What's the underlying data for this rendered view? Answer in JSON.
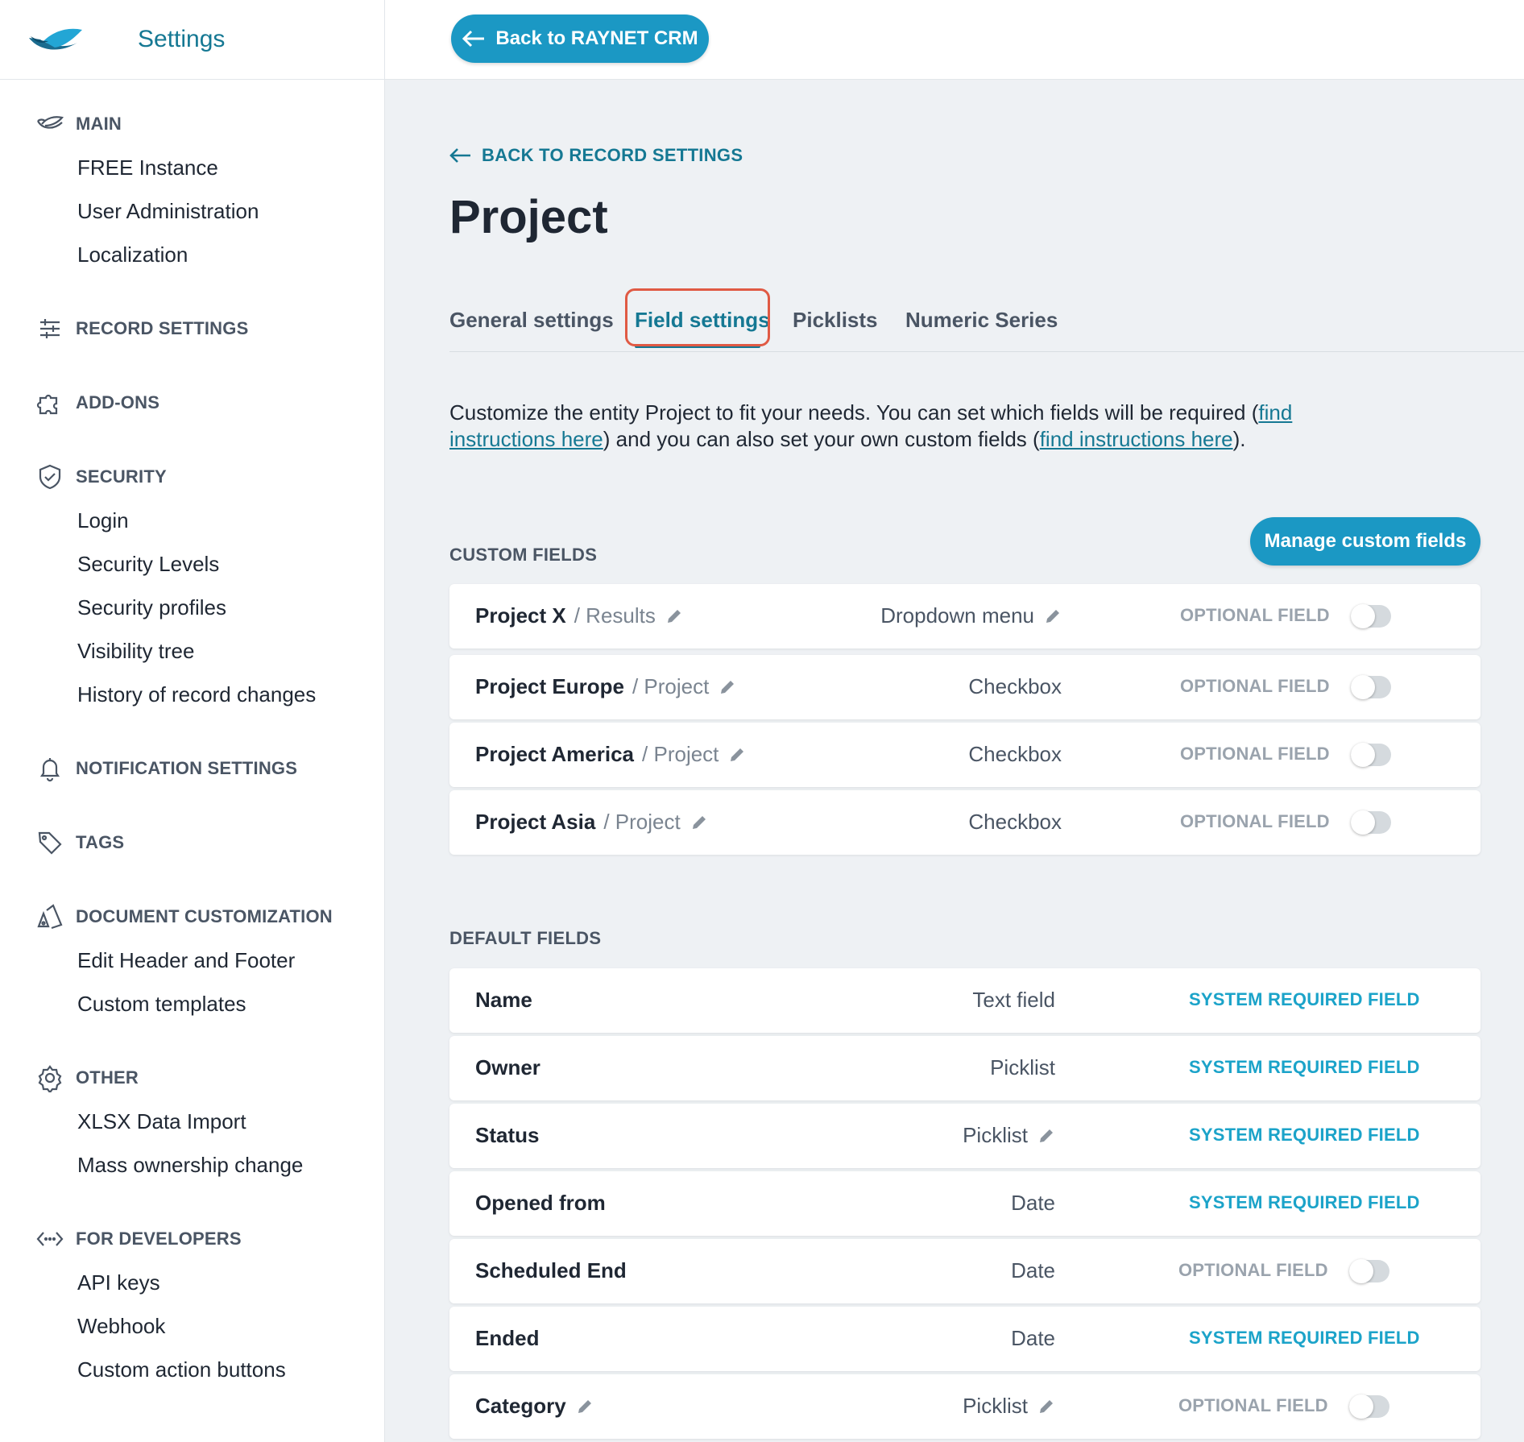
{
  "sidebar": {
    "title": "Settings",
    "groups": [
      {
        "label": "MAIN",
        "icon": "raynet-bird-icon",
        "items": [
          "FREE Instance",
          "User Administration",
          "Localization"
        ]
      },
      {
        "label": "RECORD SETTINGS",
        "icon": "sliders-icon",
        "items": []
      },
      {
        "label": "ADD-ONS",
        "icon": "puzzle-icon",
        "items": []
      },
      {
        "label": "SECURITY",
        "icon": "shield-check-icon",
        "items": [
          "Login",
          "Security Levels",
          "Security profiles",
          "Visibility tree",
          "History of record changes"
        ]
      },
      {
        "label": "NOTIFICATION SETTINGS",
        "icon": "bell-icon",
        "items": []
      },
      {
        "label": "TAGS",
        "icon": "tag-icon",
        "items": []
      },
      {
        "label": "DOCUMENT CUSTOMIZATION",
        "icon": "palette-icon",
        "items": [
          "Edit Header and Footer",
          "Custom templates"
        ]
      },
      {
        "label": "OTHER",
        "icon": "gear-icon",
        "items": [
          "XLSX Data Import",
          "Mass ownership change"
        ]
      },
      {
        "label": "FOR DEVELOPERS",
        "icon": "code-icon",
        "items": [
          "API keys",
          "Webhook",
          "Custom action buttons"
        ]
      }
    ]
  },
  "topbar": {
    "back_label": "Back to RAYNET CRM"
  },
  "main": {
    "back_link": "BACK TO RECORD SETTINGS",
    "title": "Project",
    "tabs": [
      "General settings",
      "Field settings",
      "Picklists",
      "Numeric Series"
    ],
    "active_tab": "Field settings",
    "description": {
      "part1": "Customize the entity Project to fit your needs. You can set which fields will be required (",
      "link1a": "find",
      "link1b": "instructions here",
      "part2": ") and you can also set your own custom fields (",
      "link2": "find instructions here",
      "part3": ")."
    },
    "custom_fields_heading": "CUSTOM FIELDS",
    "manage_button": "Manage custom fields",
    "default_fields_heading": "DEFAULT FIELDS",
    "custom_fields": [
      {
        "name": "Project X",
        "sub": "/ Results",
        "type": "Dropdown menu",
        "type_editable": true,
        "status": "OPTIONAL FIELD"
      },
      {
        "name": "Project Europe",
        "sub": "/ Project",
        "type": "Checkbox",
        "type_editable": false,
        "status": "OPTIONAL FIELD"
      },
      {
        "name": "Project America",
        "sub": "/ Project",
        "type": "Checkbox",
        "type_editable": false,
        "status": "OPTIONAL FIELD"
      },
      {
        "name": "Project Asia",
        "sub": "/ Project",
        "type": "Checkbox",
        "type_editable": false,
        "status": "OPTIONAL FIELD"
      }
    ],
    "default_fields": [
      {
        "name": "Name",
        "name_editable": false,
        "type": "Text field",
        "type_editable": false,
        "status": "SYSTEM REQUIRED FIELD"
      },
      {
        "name": "Owner",
        "name_editable": false,
        "type": "Picklist",
        "type_editable": false,
        "status": "SYSTEM REQUIRED FIELD"
      },
      {
        "name": "Status",
        "name_editable": false,
        "type": "Picklist",
        "type_editable": true,
        "status": "SYSTEM REQUIRED FIELD"
      },
      {
        "name": "Opened from",
        "name_editable": false,
        "type": "Date",
        "type_editable": false,
        "status": "SYSTEM REQUIRED FIELD"
      },
      {
        "name": "Scheduled End",
        "name_editable": false,
        "type": "Date",
        "type_editable": false,
        "status": "OPTIONAL FIELD"
      },
      {
        "name": "Ended",
        "name_editable": false,
        "type": "Date",
        "type_editable": false,
        "status": "SYSTEM REQUIRED FIELD"
      },
      {
        "name": "Category",
        "name_editable": true,
        "type": "Picklist",
        "type_editable": true,
        "status": "OPTIONAL FIELD"
      }
    ]
  },
  "colors": {
    "accent": "#1b98c4",
    "brand_text": "#157893",
    "highlight": "#e05a44"
  }
}
